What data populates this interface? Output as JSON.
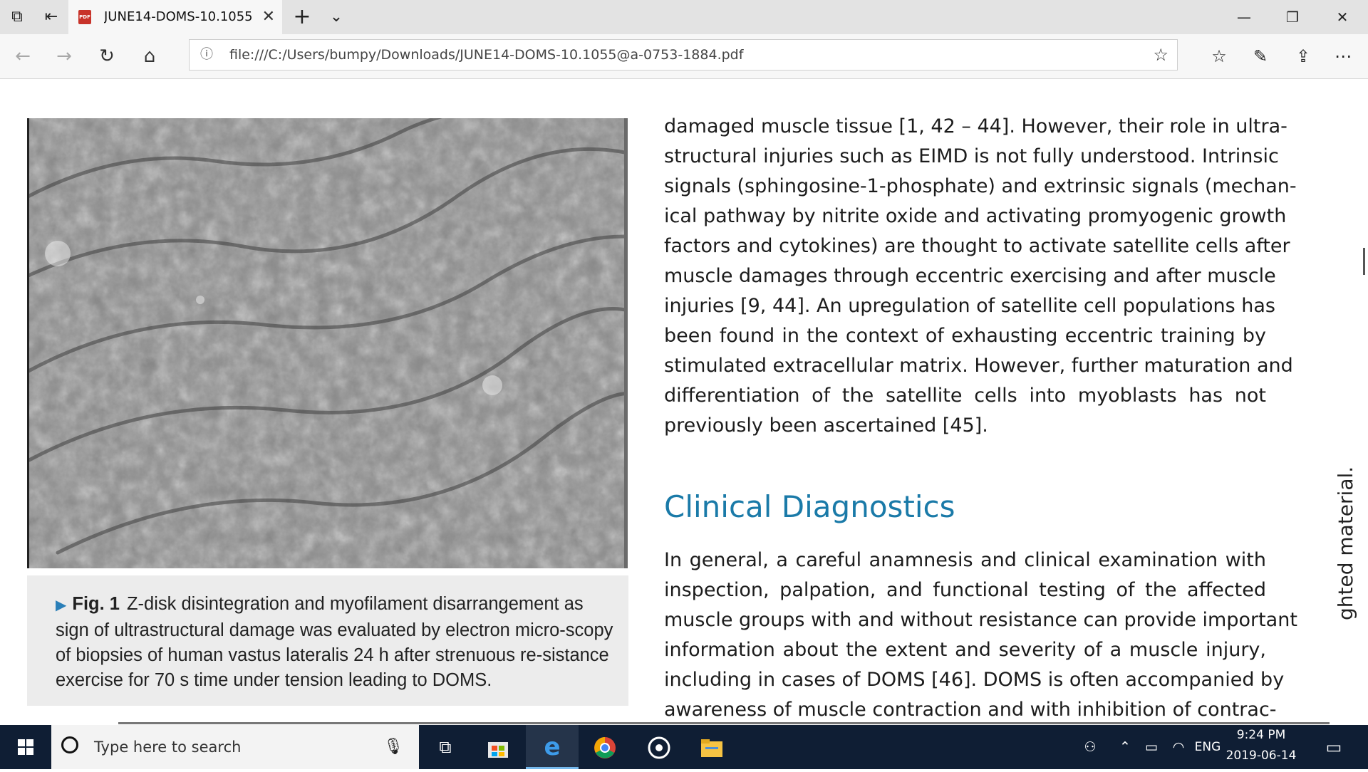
{
  "browser": {
    "tab_title": "JUNE14-DOMS-10.1055",
    "tab_icon_text": "PDF",
    "url": "file:///C:/Users/bumpy/Downloads/JUNE14-DOMS-10.1055@a-0753-1884.pdf"
  },
  "document": {
    "paragraph1_lines": [
      "damaged muscle tissue [1, 42 – 44]. However, their role in ultra-",
      "structural injuries such as EIMD is not fully understood. Intrinsic",
      "signals (sphingosine-1-phosphate) and extrinsic signals (mechan-",
      "ical pathway by nitrite oxide and activating promyogenic growth",
      "factors and cytokines) are thought to activate satellite cells after",
      "muscle damages through eccentric exercising and after muscle",
      "injuries [9, 44]. An upregulation of satellite cell populations has",
      "been found in the context of exhausting eccentric training by",
      "stimulated extracellular matrix. However, further maturation and",
      "differentiation of the satellite cells into myoblasts has not",
      "previously been ascertained [45]."
    ],
    "heading": "Clinical Diagnostics",
    "paragraph2_lines": [
      "In general, a careful anamnesis and clinical examination with",
      "inspection, palpation, and functional testing of the affected",
      "muscle groups with and without resistance can provide important",
      "information about the extent and severity of a muscle injury,",
      "including in cases of DOMS [46]. DOMS is often accompanied by",
      "awareness of muscle contraction and with inhibition of contrac-"
    ],
    "figure": {
      "label": "Fig. 1",
      "caption": "Z-disk disintegration and myofilament disarrangement as sign of ultrastructural damage was evaluated by electron micro-scopy of biopsies of human vastus lateralis 24 h after strenuous re-sistance exercise for 70 s time under tension leading to DOMS."
    },
    "side_text": "ghted material."
  },
  "taskbar": {
    "search_placeholder": "Type here to search",
    "language": "ENG",
    "time": "9:24 PM",
    "date": "2019-06-14"
  }
}
